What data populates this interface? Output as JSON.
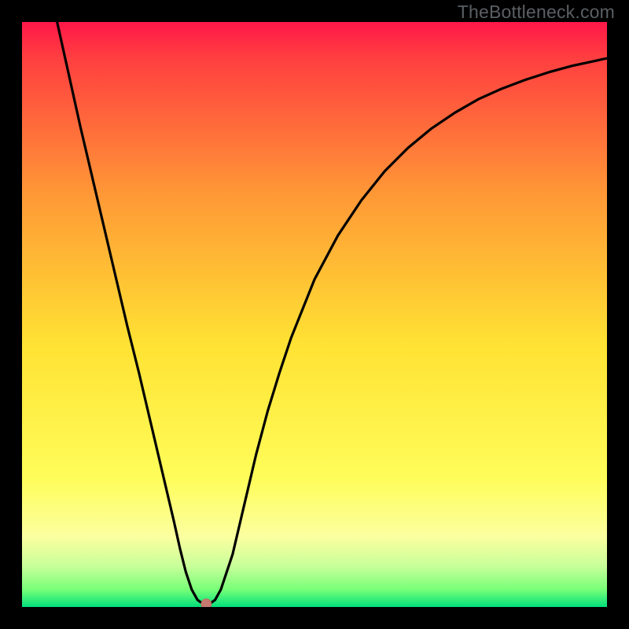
{
  "watermark": "TheBottleneck.com",
  "colors": {
    "bg": "#000000",
    "watermark_text": "#5a5f63",
    "curve": "#000000",
    "dot_fill": "#c77a6f",
    "dot_stroke": "#bb6b60",
    "gradient": {
      "top": "#ff1749",
      "red": "#ff3e40",
      "orange": "#ff9a36",
      "yellow": "#ffe233",
      "lightyellow": "#fbffa0",
      "lime": "#78ff78",
      "green": "#02e07b"
    }
  },
  "chart_data": {
    "type": "line",
    "title": "",
    "xlabel": "",
    "ylabel": "",
    "xlim": [
      0,
      100
    ],
    "ylim": [
      0,
      100
    ],
    "grid": false,
    "legend": false,
    "series": [
      {
        "name": "bottleneck-curve",
        "x": [
          6,
          8,
          10,
          12,
          14,
          16,
          18,
          20,
          22,
          24,
          26,
          27,
          28,
          29,
          30,
          31,
          32,
          33,
          34,
          36,
          38,
          40,
          42,
          44,
          46,
          50,
          54,
          58,
          62,
          66,
          70,
          74,
          78,
          82,
          86,
          90,
          94,
          100
        ],
        "y": [
          100,
          91,
          82,
          73.5,
          65,
          56.5,
          48,
          40,
          31.5,
          23,
          14.5,
          10,
          6,
          3,
          1.2,
          0.5,
          0.5,
          1.2,
          3,
          9,
          17.5,
          26,
          33.5,
          40,
          46,
          56,
          63.5,
          69.5,
          74.5,
          78.5,
          81.8,
          84.5,
          86.8,
          88.6,
          90.1,
          91.4,
          92.5,
          93.8
        ]
      }
    ],
    "annotations": [
      {
        "name": "minimum-marker",
        "x": 31.5,
        "y": 0.5
      }
    ]
  }
}
